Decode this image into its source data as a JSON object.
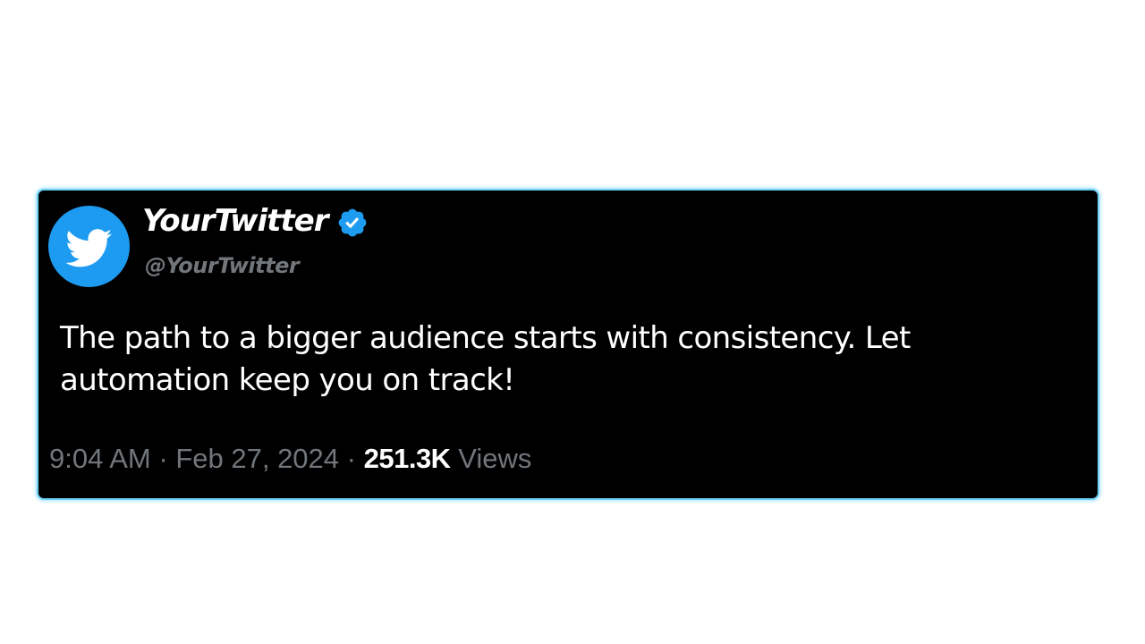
{
  "tweet": {
    "display_name": "YourTwitter",
    "handle": "@YourTwitter",
    "text": "The path to a bigger audience starts with consistency. Let automation keep you on track!",
    "time": "9:04 AM",
    "separator": "·",
    "date": "Feb 27, 2024",
    "views_count": "251.3K",
    "views_label": "Views",
    "avatar_icon": "twitter-bird-icon",
    "verified_icon": "verified-badge-icon"
  },
  "colors": {
    "card_background": "#000000",
    "card_border": "#6fd0f7",
    "accent_blue": "#1d9bf0",
    "muted_text": "#71767b",
    "primary_text": "#ffffff"
  }
}
